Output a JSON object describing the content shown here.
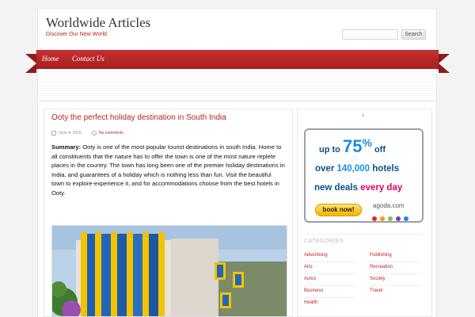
{
  "header": {
    "site_title": "Worldwide Articles",
    "tagline": "Discover Our New World"
  },
  "search": {
    "placeholder": "",
    "button_label": "Search"
  },
  "nav": {
    "items": [
      {
        "label": "Home"
      },
      {
        "label": "Contact Us"
      }
    ]
  },
  "post": {
    "title": "Ooty the perfect holiday destination in South India",
    "date": "June 4, 2015",
    "comments": "No comments",
    "summary_label": "Summary:",
    "summary_text": "Ooty is one of the most popular tourist destinations in south India. Home to all constituents that the nature has to offer the town is one of the most nature replete places in the country. The town has long been one of the premier holiday destinations in India, and guarantees of a holiday which is nothing less than fun. Visit the beautiful town to explore-experience it, and for accommodations choose from the best hotels in Ooty."
  },
  "ad": {
    "upto": "up to",
    "percent": "75",
    "percent_sign": "%",
    "off": "off",
    "over": "over",
    "hotels_count": "140,000",
    "hotels": "hotels",
    "new_deals": "new deals",
    "every_day": "every day",
    "book_now": "book now!",
    "brand": "agoda.com",
    "dot_colors": [
      "#e0262b",
      "#f59a1b",
      "#8bc34a",
      "#7b3fb0",
      "#1e88e5"
    ]
  },
  "categories": {
    "heading": "CATEGORIES",
    "left": [
      "Advertising",
      "Arts",
      "Autos",
      "Business",
      "Health"
    ],
    "right": [
      "Publishing",
      "Recreation",
      "Society",
      "Travel"
    ]
  },
  "colors": {
    "accent": "#b92323",
    "ribbon": "#b52525"
  }
}
